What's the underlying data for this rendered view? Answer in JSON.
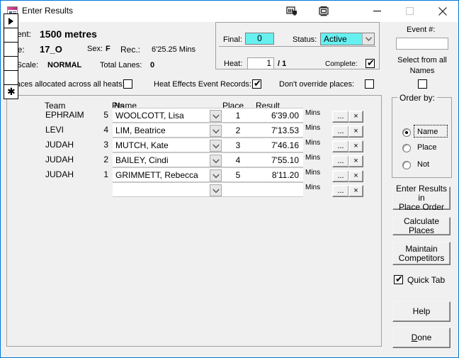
{
  "window": {
    "title": "Enter Results",
    "app_icon": "access-form-icon",
    "titlebar_icons": [
      "datasheet-view-icon",
      "form-view-icon"
    ],
    "minimize": "minimize-icon",
    "maximize": "maximize-icon",
    "close": "close-icon"
  },
  "header": {
    "event_label": "Event:",
    "event_value": "1500 metres",
    "age_label": "Age:",
    "age_value": "17_O",
    "sex_label": "Sex:",
    "sex_value": "F",
    "rec_label": "Rec.:",
    "rec_value": "6'25.25 Mins",
    "pt_scale_label": "Pt Scale:",
    "pt_scale_value": "NORMAL",
    "total_lanes_label": "Total Lanes:",
    "total_lanes_value": "0"
  },
  "status_panel": {
    "final_label": "Final:",
    "final_value": "0",
    "status_label": "Status:",
    "status_value": "Active",
    "status_options": [
      "Active"
    ],
    "heat_label": "Heat:",
    "heat_value": "1",
    "heat_separator": "/ 1",
    "complete_label": "Complete:",
    "complete_checked": true
  },
  "event_num_panel": {
    "event_num_label": "Event #:",
    "event_num_value": "",
    "select_all_names_label": "Select from all\nNames",
    "select_all_names_checked": false
  },
  "options_row": {
    "places_all_heats_label": "Places allocated across all heats:",
    "places_all_heats_checked": false,
    "heat_effects_label": "Heat Effects Event Records:",
    "heat_effects_checked": true,
    "dont_override_label": "Don't override places:",
    "dont_override_checked": false
  },
  "table": {
    "columns": [
      "Team",
      "Pts",
      "Name",
      "Place",
      "Result"
    ],
    "mins_label": "Mins",
    "ellipsis_label": "...",
    "delete_label": "×",
    "rows": [
      {
        "selector": "current",
        "team": "EPHRAIM",
        "pts": "5",
        "name": "WOOLCOTT, Lisa",
        "place": "1",
        "result": "6'39.00"
      },
      {
        "selector": "none",
        "team": "LEVI",
        "pts": "4",
        "name": "LIM, Beatrice",
        "place": "2",
        "result": "7'13.53"
      },
      {
        "selector": "none",
        "team": "JUDAH",
        "pts": "3",
        "name": "MUTCH, Kate",
        "place": "3",
        "result": "7'46.16"
      },
      {
        "selector": "none",
        "team": "JUDAH",
        "pts": "2",
        "name": "BAILEY, Cindi",
        "place": "4",
        "result": "7'55.10"
      },
      {
        "selector": "none",
        "team": "JUDAH",
        "pts": "1",
        "name": "GRIMMETT, Rebecca",
        "place": "5",
        "result": "8'11.20"
      },
      {
        "selector": "new",
        "team": "",
        "pts": "",
        "name": "",
        "place": "",
        "result": ""
      }
    ]
  },
  "order_by": {
    "title": "Order by:",
    "options": [
      {
        "label": "Name",
        "selected": true
      },
      {
        "label": "Place",
        "selected": false
      },
      {
        "label": "Not",
        "selected": false
      }
    ]
  },
  "side_buttons": {
    "enter_results": "Enter Results in\nPlace Order",
    "calculate_places": "Calculate Places",
    "maintain_competitors": "Maintain\nCompetitors",
    "quick_tab_label": "Quick Tab",
    "quick_tab_checked": true,
    "help": "Help",
    "done": "Done",
    "done_accel": "D"
  },
  "colors": {
    "cyan_field": "#66f0f0",
    "window_border": "#0078d7",
    "form_bg": "#f0f0f0"
  }
}
